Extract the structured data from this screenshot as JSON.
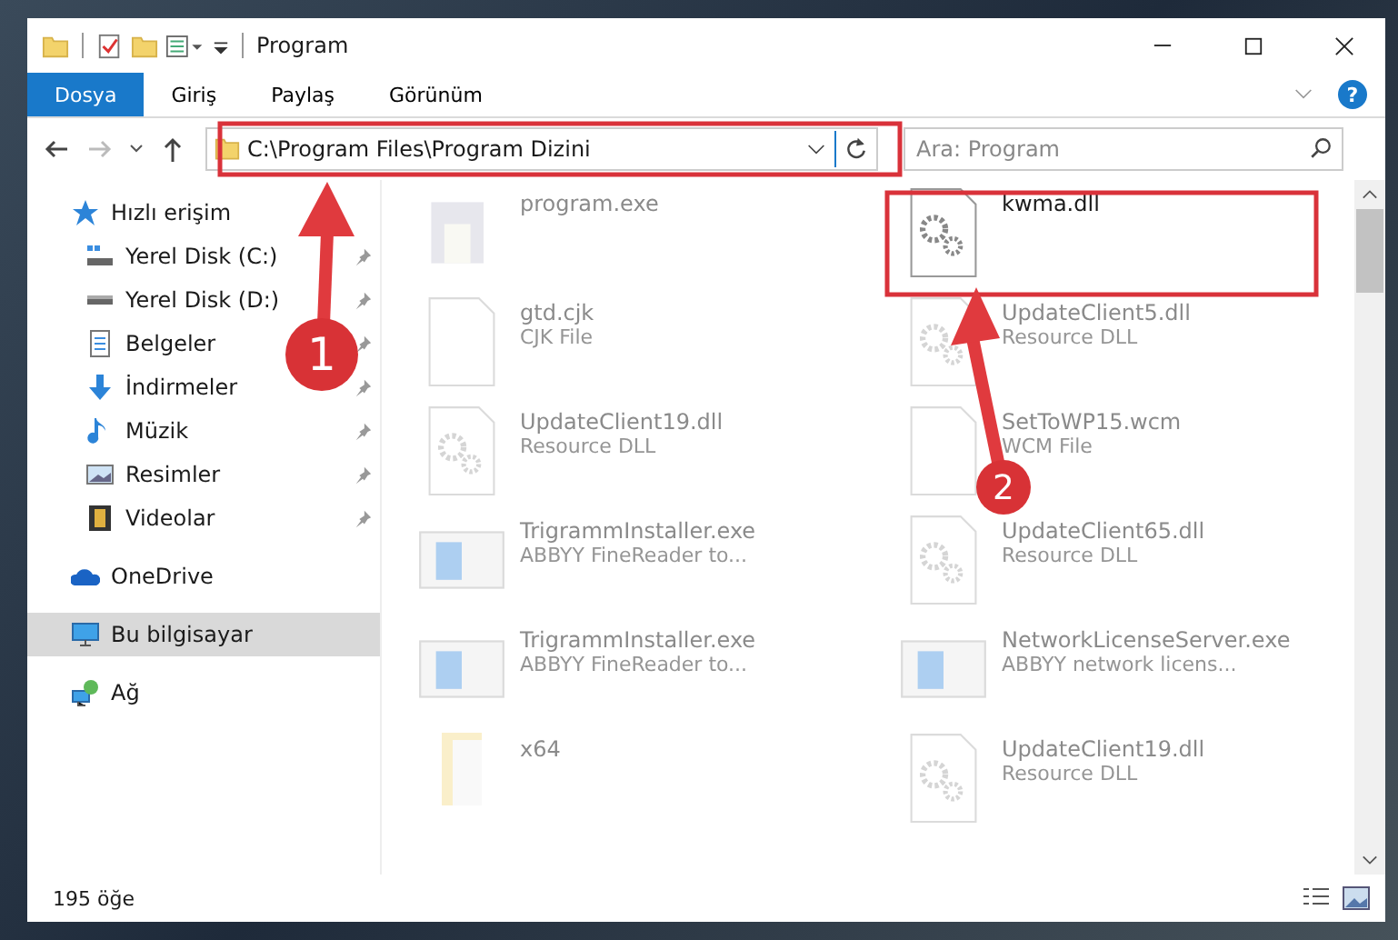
{
  "window": {
    "title": "Program"
  },
  "ribbon": {
    "tabs": [
      {
        "label": "Dosya",
        "selected": true
      },
      {
        "label": "Giriş",
        "selected": false
      },
      {
        "label": "Paylaş",
        "selected": false
      },
      {
        "label": "Görünüm",
        "selected": false
      }
    ],
    "help": "?"
  },
  "address": {
    "path": "C:\\Program Files\\Program Dizini"
  },
  "search": {
    "placeholder": "Ara: Program"
  },
  "sidebar": {
    "items": [
      {
        "label": "Hızlı erişim",
        "kind": "star",
        "selected": false,
        "children": [
          {
            "label": "Yerel Disk (C:)",
            "kind": "drive-win",
            "pinned": true
          },
          {
            "label": "Yerel Disk (D:)",
            "kind": "drive",
            "pinned": true
          },
          {
            "label": "Belgeler",
            "kind": "document",
            "pinned": true
          },
          {
            "label": "İndirmeler",
            "kind": "download",
            "pinned": true
          },
          {
            "label": "Müzik",
            "kind": "music",
            "pinned": true
          },
          {
            "label": "Resimler",
            "kind": "pictures",
            "pinned": true
          },
          {
            "label": "Videolar",
            "kind": "video",
            "pinned": true
          }
        ]
      },
      {
        "label": "OneDrive",
        "kind": "cloud",
        "selected": false
      },
      {
        "label": "Bu bilgisayar",
        "kind": "computer",
        "selected": true
      },
      {
        "label": "Ağ",
        "kind": "network",
        "selected": false
      }
    ]
  },
  "files": [
    {
      "name": "program.exe",
      "kind": "installer",
      "faded": true
    },
    {
      "name": "kwma.dll",
      "kind": "gear-file",
      "faded": false
    },
    {
      "name": "gtd.cjk",
      "type": "CJK File",
      "kind": "blank",
      "faded": true
    },
    {
      "name": "UpdateClient5.dll",
      "type": "Resource DLL",
      "kind": "dll",
      "faded": true
    },
    {
      "name": "UpdateClient19.dll",
      "type": "Resource DLL",
      "kind": "dll",
      "faded": true
    },
    {
      "name": "SetToWP15.wcm",
      "type": "WCM File",
      "kind": "blank",
      "faded": true
    },
    {
      "name": "TrigrammInstaller.exe",
      "type": "ABBYY FineReader to...",
      "kind": "app",
      "faded": true
    },
    {
      "name": "UpdateClient65.dll",
      "type": "Resource DLL",
      "kind": "dll",
      "faded": true
    },
    {
      "name": "TrigrammInstaller.exe",
      "type": "ABBYY FineReader to...",
      "kind": "app",
      "faded": true
    },
    {
      "name": "NetworkLicenseServer.exe",
      "type": "ABBYY network licens...",
      "kind": "app",
      "faded": true
    },
    {
      "name": "x64",
      "kind": "folder",
      "faded": true
    },
    {
      "name": "UpdateClient19.dll",
      "type": "Resource DLL",
      "kind": "dll",
      "faded": true
    }
  ],
  "status_bar": {
    "count": "195 öğe"
  },
  "annotations": [
    {
      "label": "1"
    },
    {
      "label": "2"
    }
  ]
}
